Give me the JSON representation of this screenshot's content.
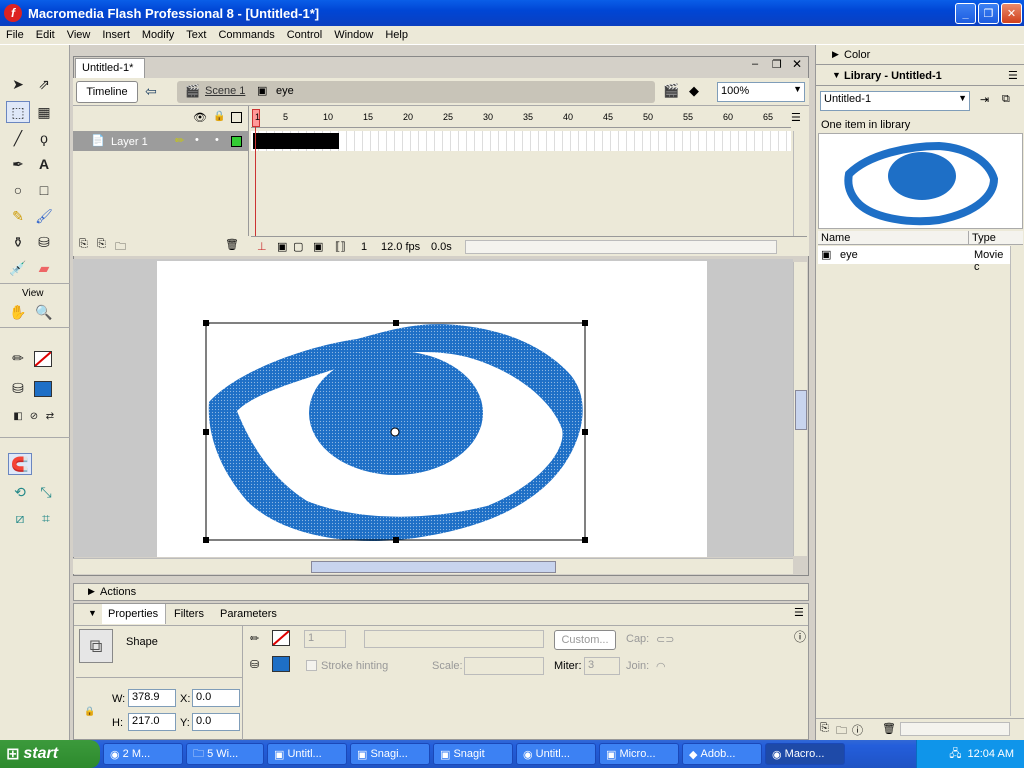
{
  "window": {
    "title": "Macromedia Flash Professional 8 - [Untitled-1*]",
    "app_icon": "f"
  },
  "menu": [
    "File",
    "Edit",
    "View",
    "Insert",
    "Modify",
    "Text",
    "Commands",
    "Control",
    "Window",
    "Help"
  ],
  "toolbox": {
    "view_label": "View"
  },
  "document": {
    "tab": "Untitled-1*",
    "timeline_button": "Timeline",
    "scene": "Scene 1",
    "symbol": "eye",
    "zoom": "100%"
  },
  "timeline": {
    "frame_numbers": [
      "1",
      "5",
      "10",
      "15",
      "20",
      "25",
      "30",
      "35",
      "40",
      "45",
      "50",
      "55",
      "60",
      "65"
    ],
    "layer_name": "Layer 1",
    "current_frame": "1",
    "fps": "12.0 fps",
    "time": "0.0s"
  },
  "right_panel": {
    "color_title": "Color",
    "library_title": "Library - Untitled-1",
    "library_select": "Untitled-1",
    "item_count": "One item in library",
    "col_name": "Name",
    "col_type": "Type",
    "item_name": "eye",
    "item_type": "Movie c"
  },
  "actions": {
    "title": "Actions"
  },
  "properties": {
    "tabs": [
      "Properties",
      "Filters",
      "Parameters"
    ],
    "shape_label": "Shape",
    "stroke_height": "1",
    "custom_button": "Custom...",
    "cap_label": "Cap:",
    "stroke_hinting": "Stroke hinting",
    "scale_label": "Scale:",
    "miter_label": "Miter:",
    "miter_value": "3",
    "join_label": "Join:",
    "w_label": "W:",
    "w_value": "378.9",
    "x_label": "X:",
    "x_value": "0.0",
    "h_label": "H:",
    "h_value": "217.0",
    "y_label": "Y:",
    "y_value": "0.0"
  },
  "colors": {
    "fill": "#1e6fc6",
    "stroke": "#ffffff"
  },
  "taskbar": {
    "start": "start",
    "tasks": [
      "2 M...",
      "5 Wi...",
      "Untitl...",
      "Snagi...",
      "Snagit",
      "Untitl...",
      "Micro...",
      "Adob...",
      "Macro..."
    ],
    "clock": "12:04 AM"
  }
}
